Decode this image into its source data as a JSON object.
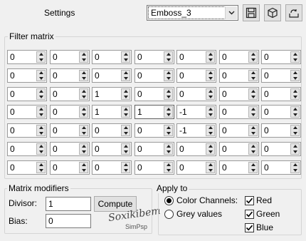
{
  "header": {
    "title": "Settings",
    "preset_value": "Emboss_3"
  },
  "matrix": {
    "title": "Filter matrix",
    "rows": [
      [
        "0",
        "0",
        "0",
        "0",
        "0",
        "0",
        "0"
      ],
      [
        "0",
        "0",
        "0",
        "0",
        "0",
        "0",
        "0"
      ],
      [
        "0",
        "0",
        "1",
        "0",
        "0",
        "0",
        "0"
      ],
      [
        "0",
        "0",
        "1",
        "1",
        "-1",
        "0",
        "0"
      ],
      [
        "0",
        "0",
        "0",
        "0",
        "-1",
        "0",
        "0"
      ],
      [
        "0",
        "0",
        "0",
        "0",
        "0",
        "0",
        "0"
      ],
      [
        "0",
        "0",
        "0",
        "0",
        "0",
        "0",
        "0"
      ]
    ]
  },
  "modifiers": {
    "title": "Matrix modifiers",
    "divisor_label": "Divisor:",
    "divisor_value": "1",
    "compute_label": "Compute",
    "bias_label": "Bias:",
    "bias_value": "0"
  },
  "apply": {
    "title": "Apply to",
    "color_channels_label": "Color Channels:",
    "grey_values_label": "Grey values",
    "selected": "color",
    "red_label": "Red",
    "green_label": "Green",
    "blue_label": "Blue",
    "red_checked": true,
    "green_checked": true,
    "blue_checked": true
  },
  "watermark": {
    "signature": "Soxikibem",
    "subtitle": "SimPsp"
  },
  "icons": {
    "save": "save-icon",
    "import": "import-icon",
    "reset": "reset-icon",
    "dropdown": "chevron-down-icon"
  }
}
